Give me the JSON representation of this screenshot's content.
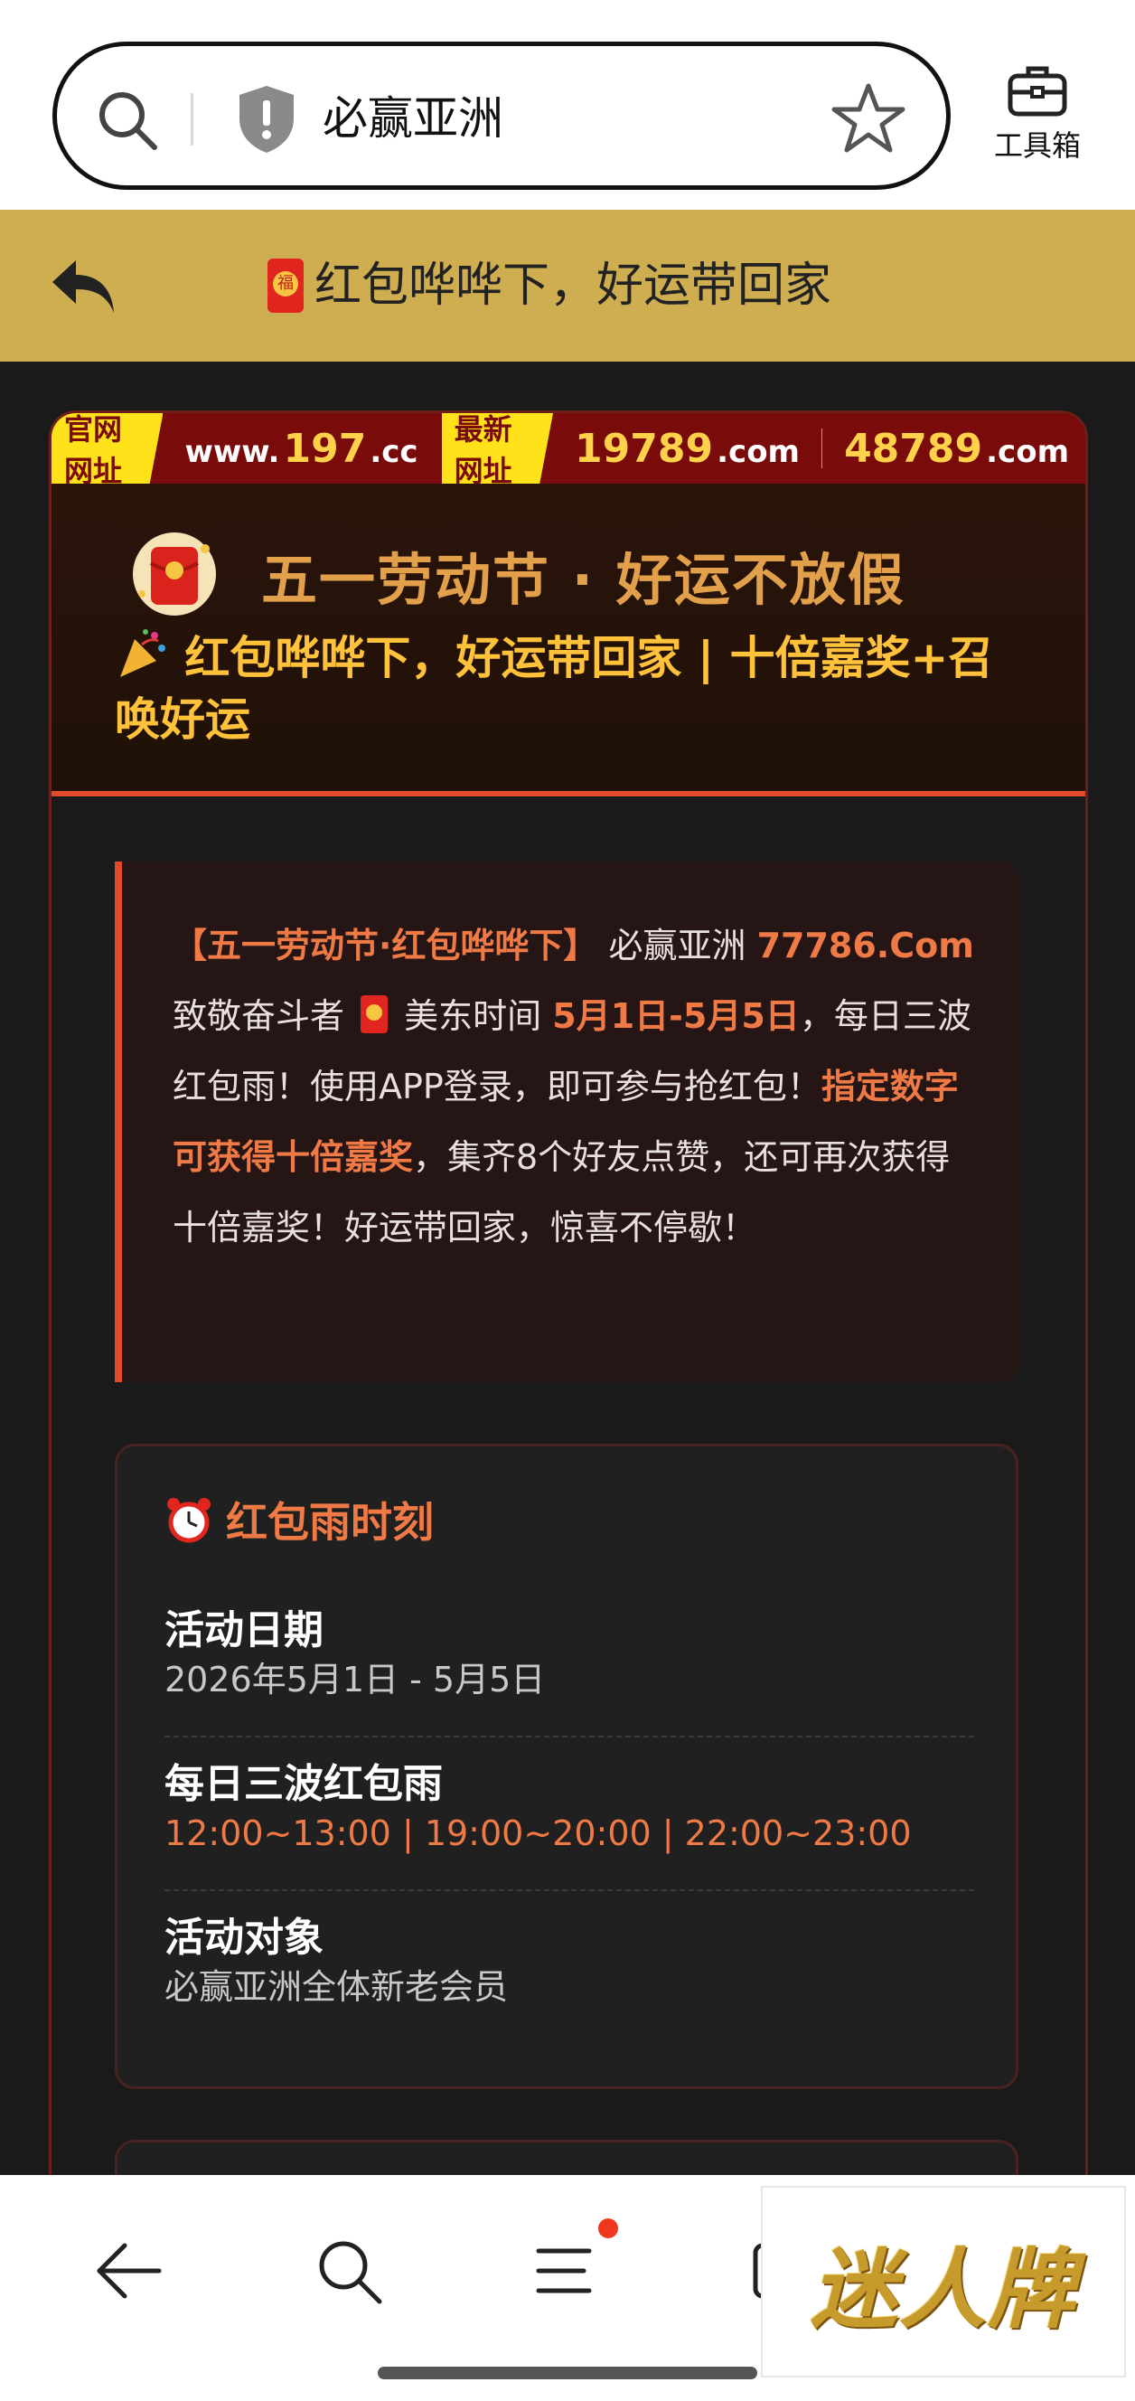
{
  "browser": {
    "query": "必赢亚洲",
    "toolbox_label": "工具箱"
  },
  "header": {
    "title": "红包哗哗下，好运带回家"
  },
  "urlbar": {
    "official_tag": "官网网址",
    "official_prefix": "www.",
    "official_num": "197",
    "official_suffix": ".cc",
    "latest_tag": "最新网址",
    "latest1_num": "19789",
    "latest1_suffix": ".com",
    "latest2_num": "48789",
    "latest2_suffix": ".com"
  },
  "hero": {
    "title": "五一劳动节 · 好运不放假",
    "subtitle": "红包哗哗下，好运带回家 | 十倍嘉奖+召唤好运"
  },
  "notice": {
    "part1": "【五一劳动节·红包哗哗下】",
    "part2": " 必赢亚洲 ",
    "part3": "77786.Com",
    "part4": " 致敬奋斗者 ",
    "part5": " 美东时间 ",
    "part6": "5月1日-5月5日",
    "part7": "，每日三波红包雨！使用APP登录，即可参与抢红包！",
    "part8": "指定数字可获得十倍嘉奖",
    "part9": "，集齐8个好友点赞，还可再次获得十倍嘉奖！好运带回家，惊喜不停歇！"
  },
  "schedule": {
    "heading": "红包雨时刻",
    "rows": [
      {
        "label": "活动日期",
        "value": "2026年5月1日 - 5月5日"
      },
      {
        "label": "每日三波红包雨",
        "value": "12:00~13:00 | 19:00~20:00 | 22:00~23:00"
      },
      {
        "label": "活动对象",
        "value": "必赢亚洲全体新老会员"
      }
    ]
  },
  "badge": {
    "text": "迷人牌"
  },
  "colors": {
    "gold": "#cfae52",
    "accent": "#f07a45",
    "url_bar": "#7a0b0b",
    "url_tag": "#ffe21a"
  }
}
